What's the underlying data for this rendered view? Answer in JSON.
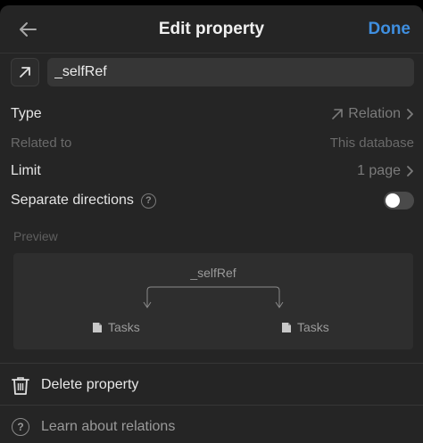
{
  "header": {
    "title": "Edit property",
    "done_label": "Done"
  },
  "property": {
    "name": "_selfRef",
    "icon": "arrow-up-right-icon"
  },
  "rows": {
    "type": {
      "label": "Type",
      "value": "Relation",
      "icon": "arrow-up-right-icon"
    },
    "related_to": {
      "label": "Related to",
      "value": "This database"
    },
    "limit": {
      "label": "Limit",
      "value": "1 page"
    },
    "separate_directions": {
      "label": "Separate directions",
      "help": "?",
      "enabled": false
    }
  },
  "preview": {
    "label": "Preview",
    "relation_name": "_selfRef",
    "left_node": "Tasks",
    "right_node": "Tasks"
  },
  "actions": {
    "delete_label": "Delete property",
    "learn_label": "Learn about relations",
    "learn_icon_text": "?"
  },
  "colors": {
    "accent": "#3f8fe0",
    "background": "#252525",
    "input_bg": "#363636"
  }
}
